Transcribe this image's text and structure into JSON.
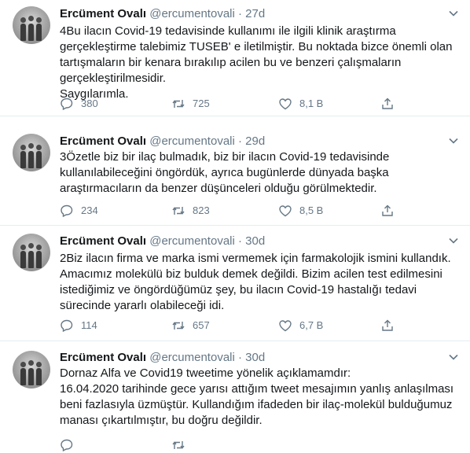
{
  "tweets": [
    {
      "name": "Ercüment Ovalı",
      "handle": "@ercumentovali",
      "dot": "·",
      "time": "27d",
      "text": "4Bu ilacın Covid-19 tedavisinde kullanımı ile ilgili klinik araştırma gerçekleştirme talebimiz TUSEB' e iletilmiştir. Bu noktada bizce önemli olan tartışmaların bir kenara bırakılıp acilen bu ve benzeri çalışmaların gerçekleştirilmesidir.\nSaygılarımla.",
      "replies": "380",
      "retweets": "725",
      "likes": "8,1 B"
    },
    {
      "name": "Ercüment Ovalı",
      "handle": "@ercumentovali",
      "dot": "·",
      "time": "29d",
      "text": "3Özetle biz bir ilaç bulmadık, biz bir ilacın Covid-19 tedavisinde kullanılabileceğini öngördük, ayrıca bugünlerde dünyada başka araştırmacıların da benzer düşünceleri olduğu görülmektedir.",
      "replies": "234",
      "retweets": "823",
      "likes": "8,5 B"
    },
    {
      "name": "Ercüment Ovalı",
      "handle": "@ercumentovali",
      "dot": "·",
      "time": "30d",
      "text": "2Biz ilacın firma ve marka ismi vermemek için farmakolojik ismini kullandık. Amacımız molekülü biz bulduk demek değildi. Bizim acilen test edilmesini istediğimiz ve öngördüğümüz şey, bu ilacın Covid-19 hastalığı tedavi sürecinde yararlı olabileceği idi.",
      "replies": "114",
      "retweets": "657",
      "likes": "6,7 B"
    },
    {
      "name": "Ercüment Ovalı",
      "handle": "@ercumentovali",
      "dot": "·",
      "time": "30d",
      "text": "Dornaz Alfa ve Covid19 tweetime yönelik açıklamamdır:\n16.04.2020 tarihinde gece yarısı attığım tweet mesajımın yanlış anlaşılması beni fazlasıyla üzmüştür. Kullandığım ifadeden bir ilaç-molekül bulduğumuz manası çıkartılmıştır, bu doğru değildir.",
      "replies": "",
      "retweets": "",
      "likes": ""
    }
  ],
  "icons": {
    "reply": "reply-icon",
    "retweet": "retweet-icon",
    "like": "heart-icon",
    "share": "share-icon",
    "caret": "chevron-down-icon"
  },
  "colors": {
    "text": "#14171a",
    "secondary": "#657786",
    "divider": "#e6ecf0"
  }
}
